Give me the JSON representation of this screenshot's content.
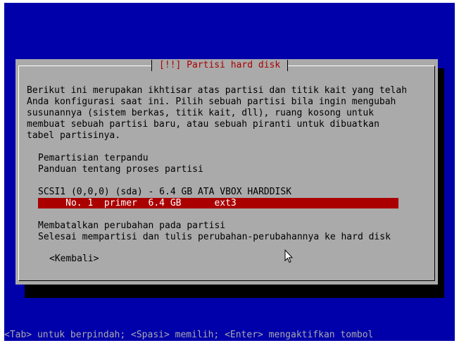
{
  "dialog": {
    "title": "[!!] Partisi hard disk",
    "description": [
      "Berikut ini merupakan ikhtisar atas partisi dan titik kait yang telah",
      "Anda konfigurasi saat ini. Pilih sebuah partisi bila ingin mengubah",
      "susunannya (sistem berkas, titik kait, dll), ruang kosong untuk",
      "membuat sebuah partisi baru, atau sebuah piranti untuk dibuatkan",
      "tabel partisinya."
    ],
    "options": {
      "guided": "Pemartisian terpandu",
      "help": "Panduan tentang proses partisi",
      "disk": "SCSI1 (0,0,0) (sda) - 6.4 GB ATA VBOX HARDDISK",
      "partition": "     No. 1  primer  6.4 GB      ext3",
      "undo": "Membatalkan perubahan pada partisi",
      "finish": "Selesai mempartisi dan tulis perubahan-perubahannya ke hard disk"
    },
    "back_button": "<Kembali>"
  },
  "status_bar": "<Tab> untuk berpindah; <Spasi> memilih; <Enter> mengaktifkan tombol",
  "colors": {
    "background": "#0000aa",
    "dialog": "#aaaaaa",
    "title": "#aa0000",
    "selection": "#aa0000"
  }
}
